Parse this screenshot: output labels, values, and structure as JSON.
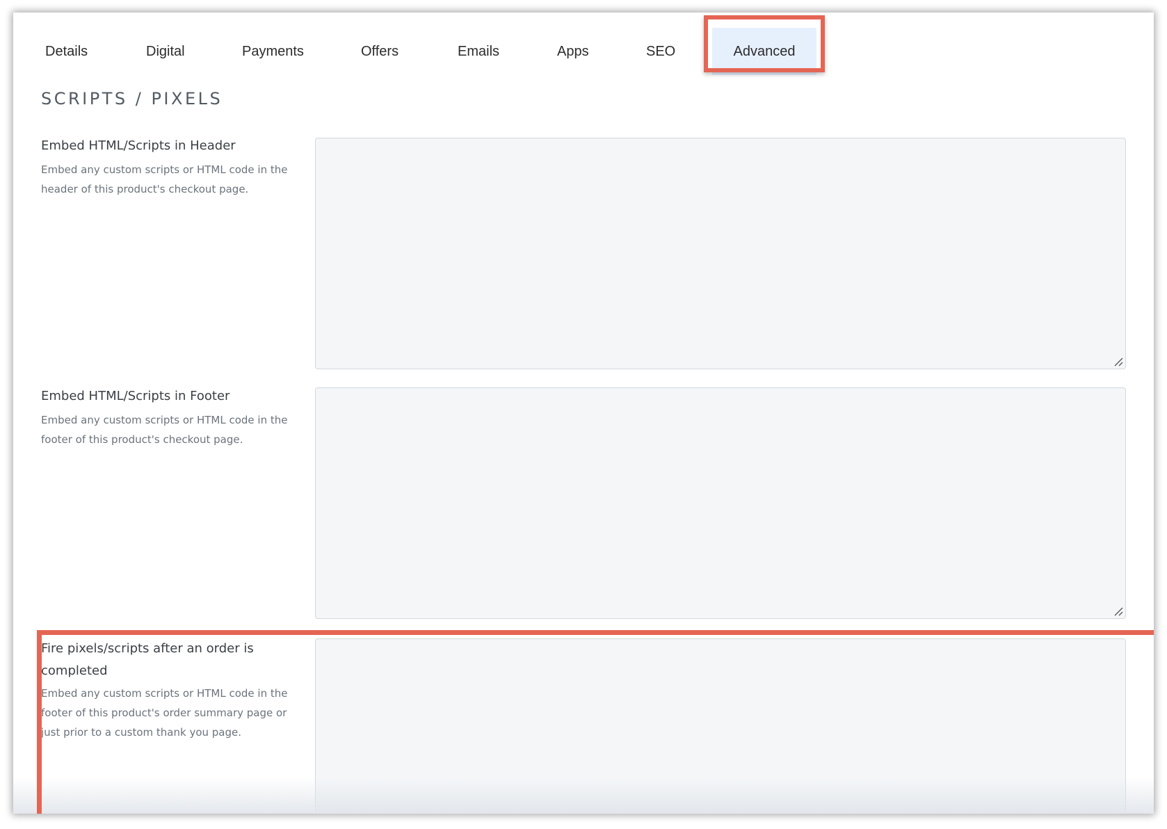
{
  "tabs": [
    {
      "label": "Details"
    },
    {
      "label": "Digital"
    },
    {
      "label": "Payments"
    },
    {
      "label": "Offers"
    },
    {
      "label": "Emails"
    },
    {
      "label": "Apps"
    },
    {
      "label": "SEO"
    },
    {
      "label": "Advanced",
      "active": true
    }
  ],
  "section": {
    "title": "SCRIPTS / PIXELS"
  },
  "fields": [
    {
      "label": "Embed HTML/Scripts in Header",
      "help": "Embed any custom scripts or HTML code in the header of this product's checkout page.",
      "value": ""
    },
    {
      "label": "Embed HTML/Scripts in Footer",
      "help": "Embed any custom scripts or HTML code in the footer of this product's checkout page.",
      "value": ""
    },
    {
      "label": "Fire pixels/scripts after an order is completed",
      "help": "Embed any custom scripts or HTML code in the footer of this product's order summary page or just prior to a custom thank you page.",
      "value": ""
    }
  ],
  "colors": {
    "highlight": "#e56555",
    "active_tab_bg": "#e6f0fd",
    "textarea_bg": "#f4f6f8"
  },
  "icons": {
    "resize": "resize-grip-icon"
  }
}
